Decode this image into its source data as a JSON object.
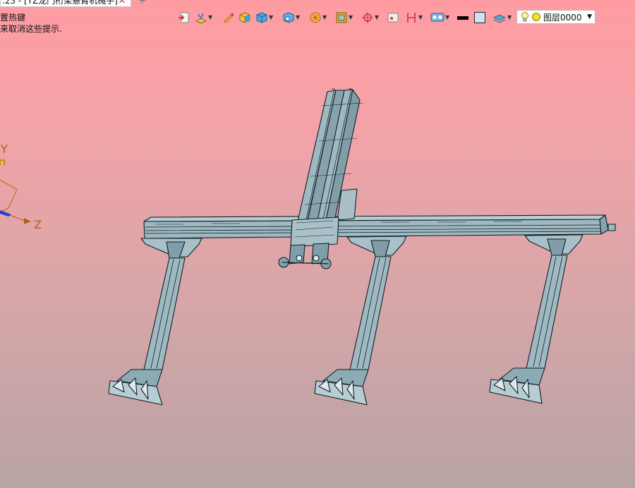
{
  "tab": {
    "title": ".23 - [YZ龙门桁架悬臂机械手]",
    "close_glyph": "✕",
    "add_glyph": "+"
  },
  "hints": {
    "line1": "置热键",
    "line2": "来取消这些提示."
  },
  "layer": {
    "label": "图层0000"
  },
  "axes": {
    "y": "Y",
    "z": "Z"
  },
  "colors": {
    "model_fill": "#9fb9c2",
    "model_stroke": "#0f1e22",
    "bg_top": "#ff9ca2",
    "bg_bottom": "#b8a3a4"
  }
}
